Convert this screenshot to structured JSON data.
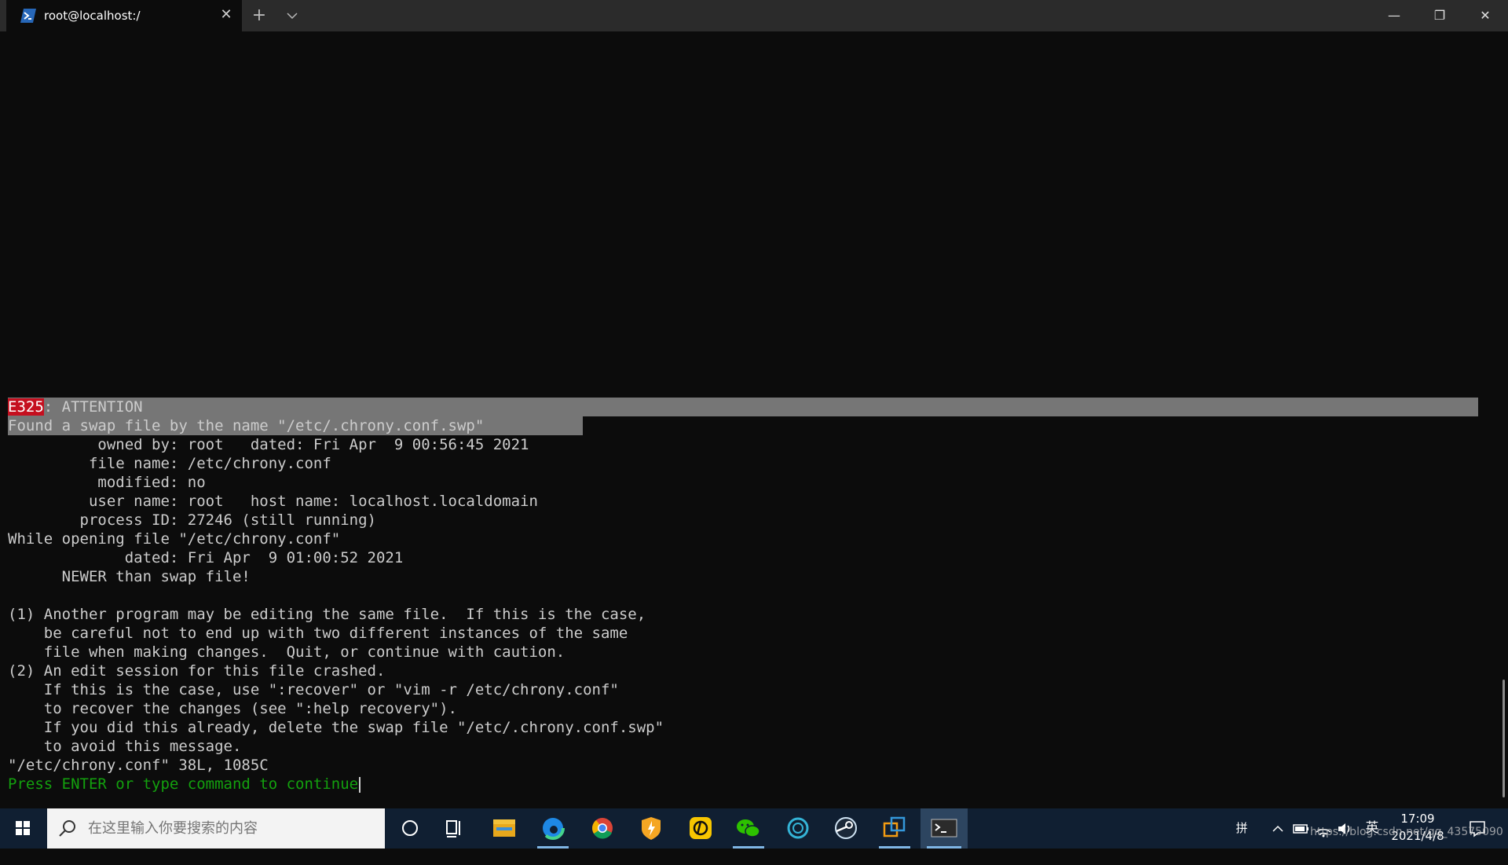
{
  "window": {
    "tab_title": "root@localhost:/",
    "new_tab_symbol": "+",
    "dropdown_symbol": "⌄",
    "tab_close_symbol": "✕",
    "minimize_symbol": "—",
    "maximize_symbol": "❐",
    "close_symbol": "✕"
  },
  "terminal": {
    "error_code": "E325",
    "error_rest": ": ATTENTION",
    "lines": [
      "Found a swap file by the name \"/etc/.chrony.conf.swp\"",
      "          owned by: root   dated: Fri Apr  9 00:56:45 2021",
      "         file name: /etc/chrony.conf",
      "          modified: no",
      "         user name: root   host name: localhost.localdomain",
      "        process ID: 27246 (still running)",
      "While opening file \"/etc/chrony.conf\"",
      "             dated: Fri Apr  9 01:00:52 2021",
      "      NEWER than swap file!",
      "",
      "(1) Another program may be editing the same file.  If this is the case,",
      "    be careful not to end up with two different instances of the same",
      "    file when making changes.  Quit, or continue with caution.",
      "(2) An edit session for this file crashed.",
      "    If this is the case, use \":recover\" or \"vim -r /etc/chrony.conf\"",
      "    to recover the changes (see \":help recovery\").",
      "    If you did this already, delete the swap file \"/etc/.chrony.conf.swp\"",
      "    to avoid this message.",
      "\"/etc/chrony.conf\" 38L, 1085C"
    ],
    "prompt": "Press ENTER or type command to continue"
  },
  "taskbar": {
    "search_placeholder": "在这里输入你要搜索的内容",
    "apps": [
      "cortana-icon",
      "task-view-icon",
      "file-explorer-icon",
      "edge-icon",
      "chrome-icon",
      "security-shield-icon",
      "music-app-icon",
      "wechat-icon",
      "vpn-app-icon",
      "steam-icon",
      "remote-desktop-icon",
      "terminal-icon"
    ],
    "ime_mode": "英",
    "ime_grid": "拼",
    "clock_time": "17:09",
    "clock_date": "2021/4/8",
    "watermark": "https://blog.csdn.net/qq_43575090"
  },
  "colors": {
    "terminal_bg": "#0c0c0c",
    "terminal_fg": "#cccccc",
    "highlight_bg": "#767676",
    "error_bg": "#c50f1f",
    "prompt_fg": "#13a10e",
    "taskbar_bg": "#101f32"
  }
}
